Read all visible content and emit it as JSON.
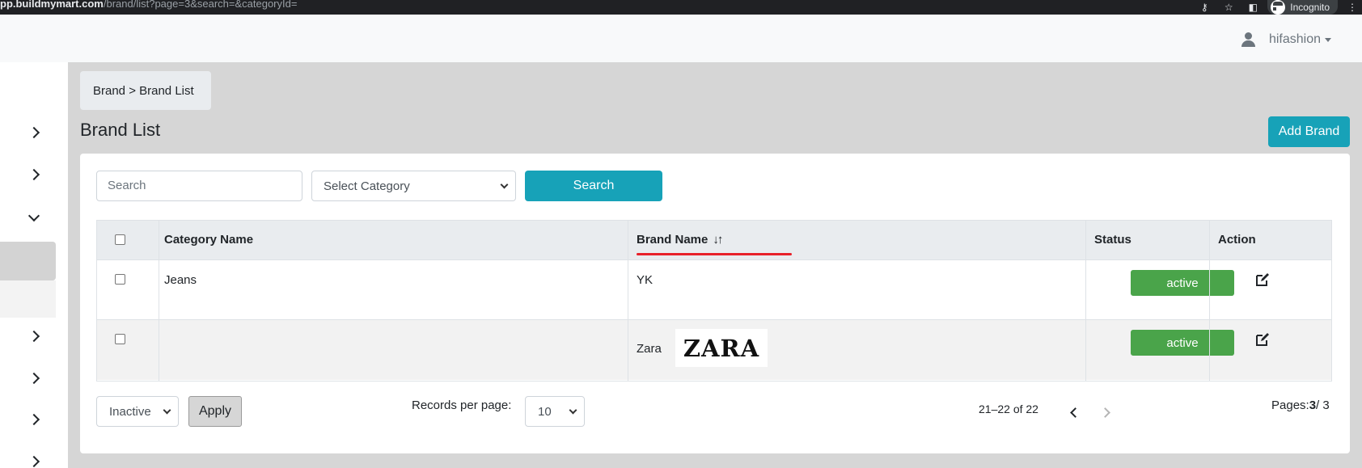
{
  "browser": {
    "url_host": "pp.buildmymart.com",
    "url_path": "/brand/list?page=3&search=&categoryId=",
    "incognito_label": "Incognito"
  },
  "navbar": {
    "username": "hifashion"
  },
  "breadcrumb": {
    "text": "Brand > Brand List"
  },
  "page": {
    "title": "Brand List",
    "add_button": "Add Brand"
  },
  "filters": {
    "search_placeholder": "Search",
    "category_selected": "Select Category",
    "search_button": "Search"
  },
  "table": {
    "columns": {
      "category": "Category Name",
      "brand": "Brand Name",
      "brand_sort_icon": "↓↑",
      "status": "Status",
      "action": "Action"
    },
    "rows": [
      {
        "category": "Jeans",
        "brand": "YK",
        "status": "active",
        "logo_text": ""
      },
      {
        "category": "",
        "brand": "Zara",
        "status": "active",
        "logo_text": "ZARA"
      }
    ]
  },
  "footer": {
    "bulk_status_selected": "Inactive",
    "apply_button": "Apply",
    "records_per_page_label": "Records per page:",
    "records_per_page_value": "10",
    "range_text": "21–22 of 22",
    "pages_label": "Pages:",
    "current_page": "3",
    "total_pages": "/ 3"
  },
  "colors": {
    "primary": "#17a2b8",
    "success": "#4aa44a",
    "highlight_underline": "#e8212a"
  }
}
